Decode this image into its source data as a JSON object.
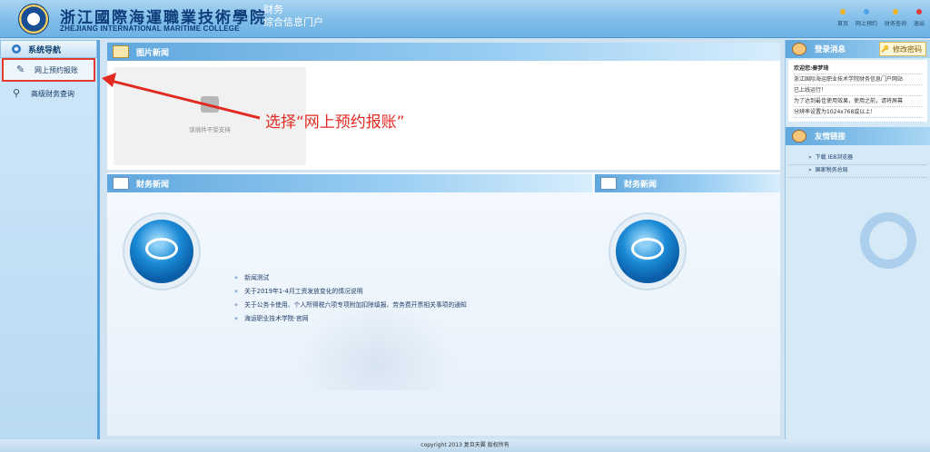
{
  "header": {
    "school_name_cn": "浙江國際海運職業技術學院",
    "school_name_en": "ZHEJIANG INTERNATIONAL MARITIME COLLEGE",
    "system_line1": "财务",
    "system_line2": "综合信息门户",
    "top_links": [
      {
        "label": "首页",
        "icon": "home-icon",
        "color": "#f1b323"
      },
      {
        "label": "网上预约",
        "icon": "booking-icon",
        "color": "#4aa3e8"
      },
      {
        "label": "财务查询",
        "icon": "query-icon",
        "color": "#f1b323"
      },
      {
        "label": "退出",
        "icon": "logout-icon",
        "color": "#e03a3a"
      }
    ]
  },
  "sidebar": {
    "title": "系统导航",
    "items": [
      {
        "label": "网上预约报账",
        "icon": "edit-icon",
        "active": true
      },
      {
        "label": "高级财务查询",
        "icon": "search-icon",
        "active": false
      }
    ]
  },
  "picture_news": {
    "title": "图片新闻",
    "plugin_message": "该插件不受支持"
  },
  "annotation": "选择“网上预约报账”",
  "finance_news": {
    "title_left": "财务新闻",
    "title_right": "财务新闻",
    "items": [
      "新闻测试",
      "关于2019年1-4月工资发放变化的情况说明",
      "关于公务卡使用、个人所得税六项专项附加扣除填报、劳务费开票相关事项的通知",
      "海运职业技术学院-官网"
    ]
  },
  "right_panel": {
    "login_title": "登录消息",
    "change_password": "修改密码",
    "welcome": "欢迎您:秦梦琦",
    "msg1": "浙江国际海运职业技术学院财务信息门户网站",
    "msg2": "已上线运行！",
    "msg3": "为了达到最佳使用效果，使用之前，请将屏幕",
    "msg4": "分辨率设置为1024x768或以上！",
    "links_title": "友情链接",
    "links": [
      "下载 IE8浏览器",
      "国家税务总局"
    ]
  },
  "footer": {
    "text": "copyright 2013 复旦天翼 版权所有"
  },
  "colors": {
    "accent_red": "#e32a22",
    "header_blue": "#7cbbe8"
  }
}
